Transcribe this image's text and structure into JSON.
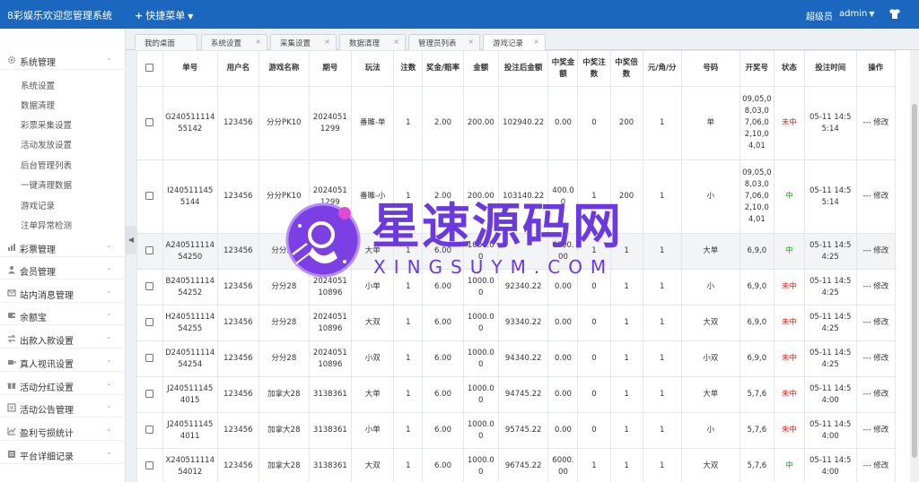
{
  "header": {
    "app_title": "8彩娱乐欢迎您管理系统",
    "quick_menu_label": "快捷菜单",
    "user_role": "超级员",
    "user_name": "admin"
  },
  "sidebar": {
    "groups": [
      {
        "label": "系统管理",
        "icon": "gear-icon",
        "expanded": true
      },
      {
        "label": "彩票管理",
        "icon": "chart-icon"
      },
      {
        "label": "会员管理",
        "icon": "user-icon"
      },
      {
        "label": "站内消息管理",
        "icon": "message-icon"
      },
      {
        "label": "余额宝",
        "icon": "wallet-icon"
      },
      {
        "label": "出款入款设置",
        "icon": "transfer-icon"
      },
      {
        "label": "真人视讯设置",
        "icon": "video-icon"
      },
      {
        "label": "活动分红设置",
        "icon": "gift-icon"
      },
      {
        "label": "活动公告管理",
        "icon": "notice-icon"
      },
      {
        "label": "盈利亏损统计",
        "icon": "stats-icon"
      },
      {
        "label": "平台详细记录",
        "icon": "record-icon"
      }
    ],
    "items": [
      "系统设置",
      "数据清理",
      "彩票采集设置",
      "活动发放设置",
      "后台管理列表",
      "一键清理数据",
      "游戏记录",
      "注单异常检测"
    ]
  },
  "tabs": [
    {
      "label": "我的桌面",
      "closable": false
    },
    {
      "label": "系统设置",
      "closable": true
    },
    {
      "label": "采集设置",
      "closable": true
    },
    {
      "label": "数据清理",
      "closable": true
    },
    {
      "label": "管理员列表",
      "closable": true
    },
    {
      "label": "游戏记录",
      "closable": true,
      "active": true
    }
  ],
  "table": {
    "columns": [
      "单号",
      "用户名",
      "游戏名称",
      "期号",
      "玩法",
      "注数",
      "奖金/赔率",
      "金额",
      "投注后金额",
      "中奖金额",
      "中奖注数",
      "中奖倍数",
      "元/角/分",
      "号码",
      "开奖号",
      "状态",
      "投注时间",
      "操作"
    ],
    "rows": [
      {
        "order": "G24051111455142",
        "user": "123456",
        "game": "分分PK10",
        "period": "20240511299",
        "play": "番雎-单",
        "count": "1",
        "odds": "2.00",
        "amount": "200.00",
        "after": "102940.22",
        "win_amount": "0.00",
        "win_count": "0",
        "win_multi": "200",
        "unit": "1",
        "number": "单",
        "draw": "09,05,08,03,07,06,02,10,04,01",
        "status": "未中",
        "status_color": "red",
        "time": "05-11 14:55:14",
        "action": "--- 修改"
      },
      {
        "order": "I240511145 5144",
        "user": "123456",
        "game": "分分PK10",
        "period": "20240511299",
        "play": "番雎-小",
        "count": "1",
        "odds": "2.00",
        "amount": "200.00",
        "after": "103140.22",
        "win_amount": "400.00",
        "win_count": "1",
        "win_multi": "200",
        "unit": "1",
        "number": "小",
        "draw": "09,05,08,03,07,06,02,10,04,01",
        "status": "中",
        "status_color": "green",
        "time": "05-11 14:55:14",
        "action": "--- 修改"
      },
      {
        "order": "A24051111454250",
        "user": "123456",
        "game": "分分28",
        "period": "202405110896",
        "play": "大单",
        "count": "1",
        "odds": "6.00",
        "amount": "1000.00",
        "after": "",
        "win_amount": "6000.00",
        "win_count": "1",
        "win_multi": "1",
        "unit": "1",
        "number": "大单",
        "draw": "6,9,0",
        "status": "中",
        "status_color": "green",
        "time": "05-11 14:54:25",
        "action": "--- 修改"
      },
      {
        "order": "B24051111454252",
        "user": "123456",
        "game": "分分28",
        "period": "202405110896",
        "play": "小单",
        "count": "1",
        "odds": "6.00",
        "amount": "1000.00",
        "after": "92340.22",
        "win_amount": "0.00",
        "win_count": "0",
        "win_multi": "1",
        "unit": "1",
        "number": "小",
        "draw": "6,9,0",
        "status": "未中",
        "status_color": "red",
        "time": "05-11 14:54:25",
        "action": "--- 修改"
      },
      {
        "order": "H24051111454255",
        "user": "123456",
        "game": "分分28",
        "period": "202405110896",
        "play": "大双",
        "count": "1",
        "odds": "6.00",
        "amount": "1000.00",
        "after": "93340.22",
        "win_amount": "0.00",
        "win_count": "0",
        "win_multi": "1",
        "unit": "1",
        "number": "大双",
        "draw": "6,9,0",
        "status": "未中",
        "status_color": "red",
        "time": "05-11 14:54:25",
        "action": "--- 修改"
      },
      {
        "order": "D24051111454254",
        "user": "123456",
        "game": "分分28",
        "period": "202405110896",
        "play": "小双",
        "count": "1",
        "odds": "6.00",
        "amount": "1000.00",
        "after": "94340.22",
        "win_amount": "0.00",
        "win_count": "0",
        "win_multi": "1",
        "unit": "1",
        "number": "小双",
        "draw": "6,9,0",
        "status": "未中",
        "status_color": "red",
        "time": "05-11 14:54:25",
        "action": "--- 修改"
      },
      {
        "order": "J240511145 4015",
        "user": "123456",
        "game": "加拿大28",
        "period": "3138361",
        "play": "大单",
        "count": "1",
        "odds": "6.00",
        "amount": "1000.00",
        "after": "94745.22",
        "win_amount": "0.00",
        "win_count": "0",
        "win_multi": "1",
        "unit": "1",
        "number": "大单",
        "draw": "5,7,6",
        "status": "未中",
        "status_color": "red",
        "time": "05-11 14:54:00",
        "action": "--- 修改"
      },
      {
        "order": "J240511145 4011",
        "user": "123456",
        "game": "加拿大28",
        "period": "3138361",
        "play": "小单",
        "count": "1",
        "odds": "6.00",
        "amount": "1000.00",
        "after": "95745.22",
        "win_amount": "0.00",
        "win_count": "0",
        "win_multi": "1",
        "unit": "1",
        "number": "小",
        "draw": "5,7,6",
        "status": "未中",
        "status_color": "red",
        "time": "05-11 14:54:00",
        "action": "--- 修改"
      },
      {
        "order": "X24051111454012",
        "user": "123456",
        "game": "加拿大28",
        "period": "3138361",
        "play": "大双",
        "count": "1",
        "odds": "6.00",
        "amount": "1000.00",
        "after": "96745.22",
        "win_amount": "6000.00",
        "win_count": "1",
        "win_multi": "1",
        "unit": "1",
        "number": "大双",
        "draw": "5,7,6",
        "status": "中",
        "status_color": "green",
        "time": "05-11 14:54:00",
        "action": "--- 修改"
      }
    ]
  },
  "watermark": {
    "title": "星速源码网",
    "subtitle": "XINGSUYM.COM"
  },
  "colors": {
    "header_bg": "#1b67c0",
    "status_win": "#1aa31a",
    "status_lose": "#e1251b",
    "watermark": "#6a39e0"
  }
}
